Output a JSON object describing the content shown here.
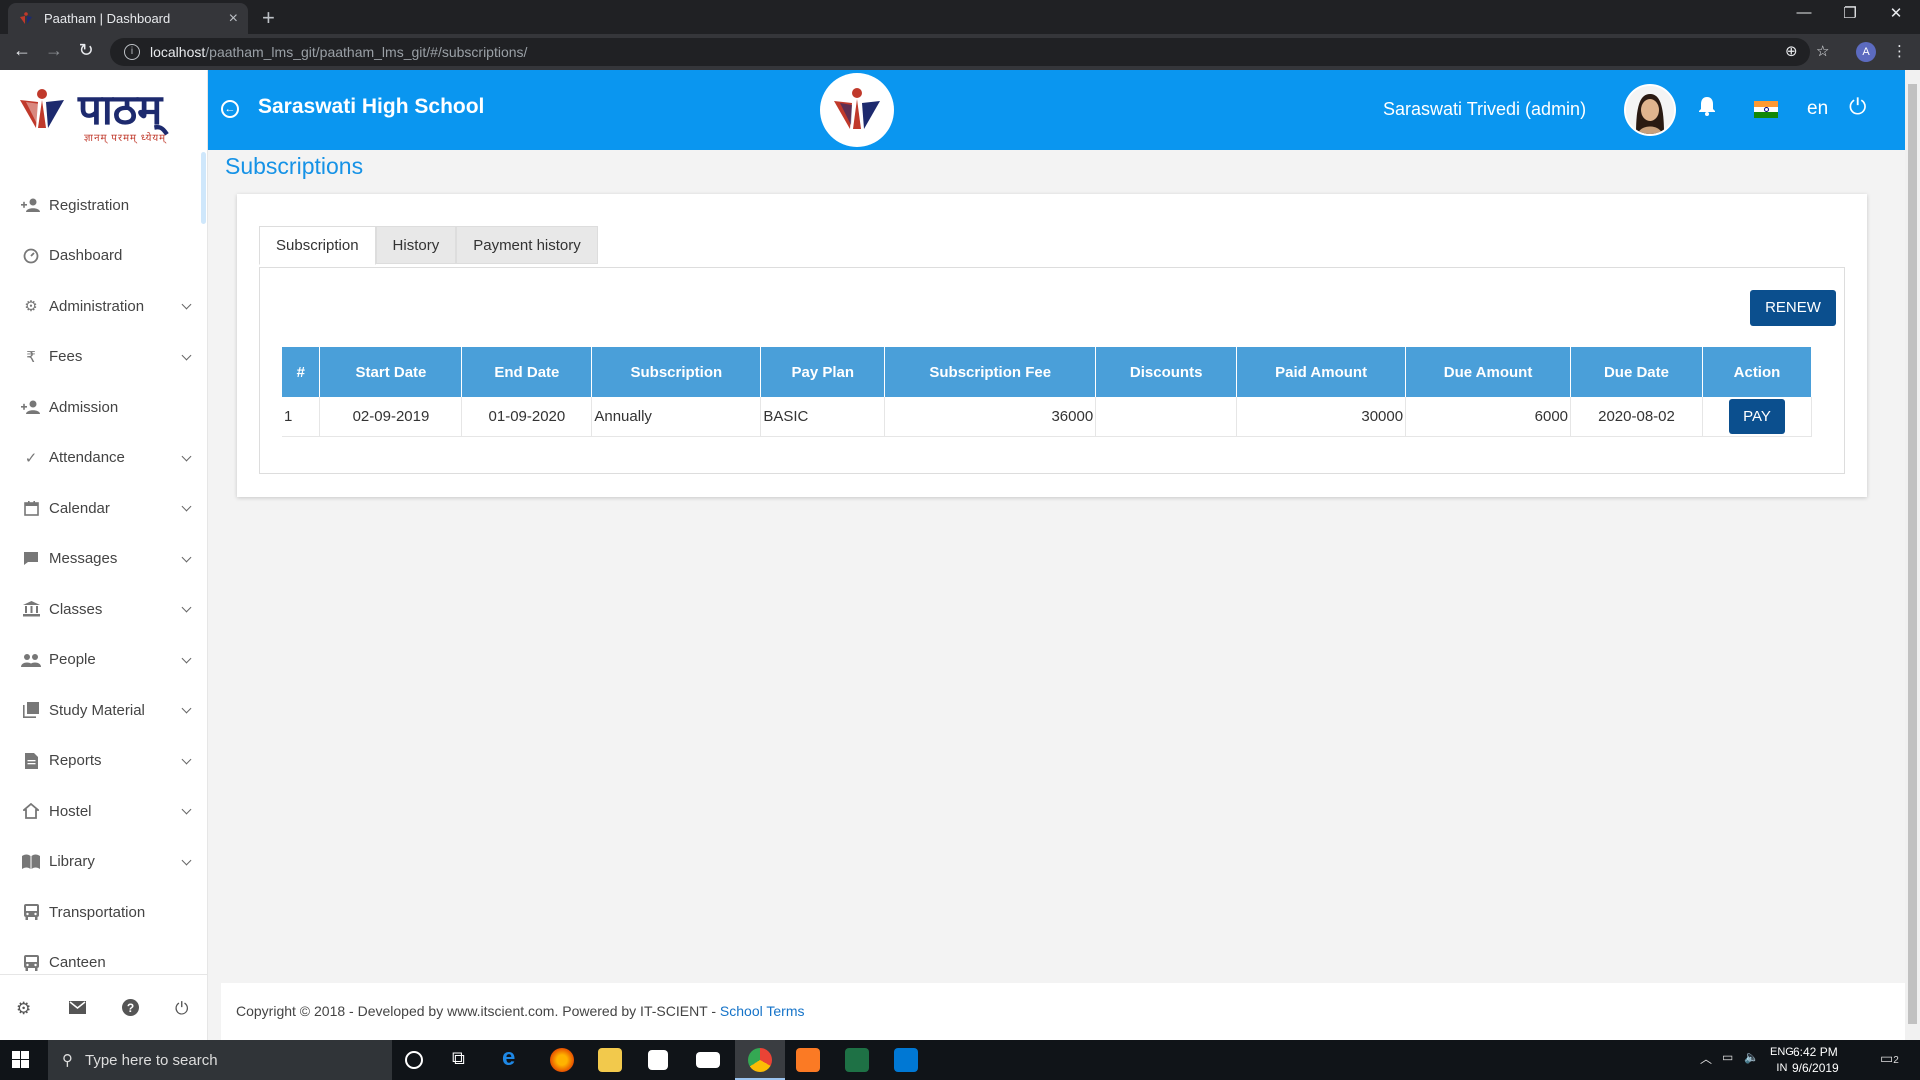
{
  "browser": {
    "tab_title": "Paatham | Dashboard",
    "tab_close": "×",
    "new_tab": "+",
    "url_host": "localhost",
    "url_path": "/paatham_lms_git/paatham_lms_git/#/subscriptions/",
    "profile_initial": "A"
  },
  "sidebar": {
    "logo_word": "पाठम्",
    "logo_tagline": "ज्ञानम् परमम् ध्येयम्",
    "items": [
      {
        "label": "Registration",
        "icon": "person-add-icon",
        "expandable": false
      },
      {
        "label": "Dashboard",
        "icon": "dashboard-icon",
        "expandable": false
      },
      {
        "label": "Administration",
        "icon": "gear-icon",
        "expandable": true
      },
      {
        "label": "Fees",
        "icon": "rupee-icon",
        "expandable": true
      },
      {
        "label": "Admission",
        "icon": "person-add-icon",
        "expandable": false
      },
      {
        "label": "Attendance",
        "icon": "check-icon",
        "expandable": true
      },
      {
        "label": "Calendar",
        "icon": "calendar-icon",
        "expandable": true
      },
      {
        "label": "Messages",
        "icon": "message-icon",
        "expandable": true
      },
      {
        "label": "Classes",
        "icon": "bank-icon",
        "expandable": true
      },
      {
        "label": "People",
        "icon": "people-icon",
        "expandable": true
      },
      {
        "label": "Study Material",
        "icon": "library-icon",
        "expandable": true
      },
      {
        "label": "Reports",
        "icon": "document-icon",
        "expandable": true
      },
      {
        "label": "Hostel",
        "icon": "home-icon",
        "expandable": true
      },
      {
        "label": "Library",
        "icon": "book-icon",
        "expandable": true
      },
      {
        "label": "Transportation",
        "icon": "bus-icon",
        "expandable": false
      },
      {
        "label": "Canteen",
        "icon": "canteen-icon",
        "expandable": false
      }
    ]
  },
  "header": {
    "school_name": "Saraswati High School",
    "user_name": "Saraswati Trivedi (admin)",
    "language": "en",
    "flag_colors": [
      "#ff9933",
      "#ffffff",
      "#138808"
    ]
  },
  "page": {
    "title": "Subscriptions",
    "tabs": [
      "Subscription",
      "History",
      "Payment history"
    ],
    "active_tab": "Subscription",
    "renew_label": "RENEW",
    "table": {
      "columns": [
        "#",
        "Start Date",
        "End Date",
        "Subscription",
        "Pay Plan",
        "Subscription Fee",
        "Discounts",
        "Paid Amount",
        "Due Amount",
        "Due Date",
        "Action"
      ],
      "rows": [
        {
          "num": "1",
          "start_date": "02-09-2019",
          "end_date": "01-09-2020",
          "subscription": "Annually",
          "pay_plan": "BASIC",
          "fee": "36000",
          "discounts": "",
          "paid": "30000",
          "due": "6000",
          "due_date": "2020-08-02",
          "action": "PAY"
        }
      ]
    }
  },
  "footer": {
    "text": "Copyright © 2018 - Developed by www.itscient.com. Powered by IT-SCIENT - ",
    "link": "School Terms"
  },
  "taskbar": {
    "search_placeholder": "Type here to search",
    "lang_line1": "ENG",
    "lang_line2": "IN",
    "time": "6:42 PM",
    "date": "9/6/2019",
    "notifications": "2"
  },
  "colors": {
    "header_blue": "#0a96f0",
    "table_header": "#4a9fd9",
    "button_navy": "#0b4f8e",
    "title_blue": "#1592e6"
  }
}
